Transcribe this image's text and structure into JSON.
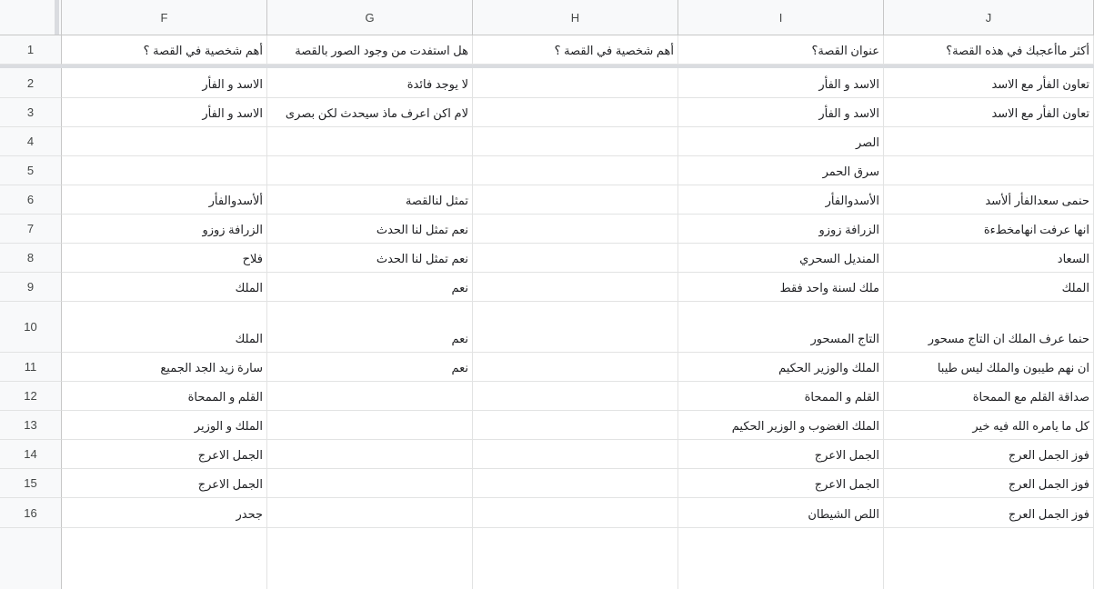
{
  "columns": [
    "F",
    "G",
    "H",
    "I",
    "J"
  ],
  "rows": [
    {
      "num": "1",
      "cells": [
        "أهم شخصية في القصة ؟",
        "هل استفدت من وجود الصور بالقصة",
        "أهم شخصية في القصة ؟",
        "عنوان القصة؟",
        "أكثر ماأعجبك في هذه القصة؟"
      ]
    },
    {
      "num": "2",
      "cells": [
        "الاسد و الفأر",
        "لا يوجد فائدة",
        "",
        "الاسد و الفأر",
        "تعاون الفأر مع الاسد"
      ]
    },
    {
      "num": "3",
      "cells": [
        "الاسد و الفأر",
        "لام اكن اعرف ماذ سيحدث لكن بصرى",
        "",
        "الاسد و الفأر",
        "تعاون الفأر مع الاسد"
      ]
    },
    {
      "num": "4",
      "cells": [
        "",
        "",
        "",
        "الصر",
        ""
      ]
    },
    {
      "num": "5",
      "cells": [
        "",
        "",
        "",
        "سرق الحمر",
        ""
      ]
    },
    {
      "num": "6",
      "cells": [
        "ألأسدوالفأر",
        "تمثل لنالقصة",
        "",
        "الأسدوالفأر",
        "حنمى سعدالفأر ألأسد"
      ]
    },
    {
      "num": "7",
      "cells": [
        "الزرافة زوزو",
        "نعم تمثل لنا الحدث",
        "",
        "الزرافة زوزو",
        "انها عرفت انهامخطءة"
      ]
    },
    {
      "num": "8",
      "cells": [
        "فلاح",
        "نعم تمثل لنا الحدث",
        "",
        "المنديل السحري",
        "السعاد"
      ]
    },
    {
      "num": "9",
      "cells": [
        "الملك",
        "نعم",
        "",
        "ملك لسنة واحد فقط",
        "الملك"
      ]
    },
    {
      "num": "10",
      "cells": [
        "الملك",
        "نعم",
        "",
        "التاج المسحور",
        "حنما عرف الملك ان التاج مسحور"
      ]
    },
    {
      "num": "11",
      "cells": [
        "سارة زيد الجد الجميع",
        "نعم",
        "",
        "الملك والوزير الحكيم",
        "ان نهم طيبون والملك ليس طيبا"
      ]
    },
    {
      "num": "12",
      "cells": [
        "القلم و الممحاة",
        "",
        "",
        "القلم و الممحاة",
        "صداقة القلم مع الممحاة"
      ]
    },
    {
      "num": "13",
      "cells": [
        "الملك و الوزير",
        "",
        "",
        "الملك الغضوب و الوزير الحكيم",
        "كل ما يامره الله فيه خير"
      ]
    },
    {
      "num": "14",
      "cells": [
        "الجمل الاعرج",
        "",
        "",
        "الجمل الاعرج",
        "فوز الجمل العرج"
      ]
    },
    {
      "num": "15",
      "cells": [
        "الجمل الاعرج",
        "",
        "",
        "الجمل الاعرج",
        "فوز الجمل العرج"
      ]
    },
    {
      "num": "16",
      "cells": [
        "جحدر",
        "",
        "",
        "اللص الشيطان",
        "فوز الجمل العرج"
      ]
    }
  ]
}
